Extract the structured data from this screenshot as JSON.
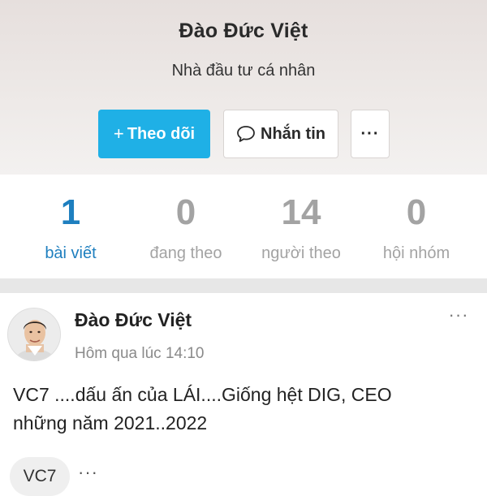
{
  "profile": {
    "name": "Đào Đức Việt",
    "role": "Nhà đầu tư cá nhân",
    "follow_label": "Theo dõi",
    "follow_icon": "+",
    "message_label": "Nhắn tin",
    "more_label": "···"
  },
  "stats": [
    {
      "value": "1",
      "label": "bài viết"
    },
    {
      "value": "0",
      "label": "đang theo"
    },
    {
      "value": "14",
      "label": "người theo"
    },
    {
      "value": "0",
      "label": "hội nhóm"
    }
  ],
  "post": {
    "author": "Đào Đức Việt",
    "time": "Hôm qua lúc 14:10",
    "more_label": "···",
    "text_line1": "VC7 ....dấu ấn của LÁI....Giống hệt DIG, CEO",
    "text_line2": "những năm 2021..2022",
    "tag": "VC7",
    "tag_more": "···"
  },
  "colors": {
    "accent": "#1fb0e6",
    "active_stat": "#1e7fbf",
    "muted": "#a3a3a3"
  }
}
